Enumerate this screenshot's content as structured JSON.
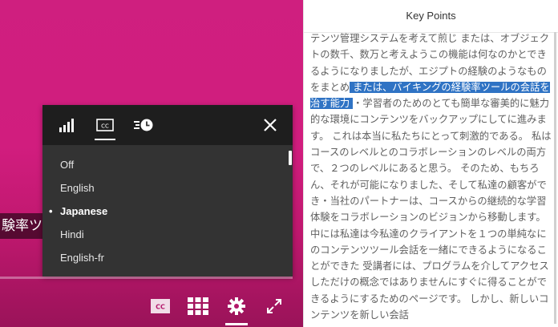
{
  "video": {
    "caption_fragment": "験率ツ",
    "background_color": "#cf1f7f"
  },
  "caption_menu": {
    "tabs": [
      {
        "icon": "signal-bars-icon"
      },
      {
        "icon": "closed-captions-icon",
        "active": true
      },
      {
        "icon": "playback-speed-icon"
      }
    ],
    "close_icon": "close-icon",
    "options": [
      "Off",
      "English",
      "Japanese",
      "Hindi",
      "English-fr"
    ],
    "selected": "Japanese",
    "bullet": "•"
  },
  "controls": {
    "buttons": [
      {
        "icon": "closed-captions-icon",
        "label": "CC"
      },
      {
        "icon": "grid-icon"
      },
      {
        "icon": "settings-gear-icon"
      },
      {
        "icon": "fullscreen-icon"
      }
    ]
  },
  "key_points": {
    "title": "Key Points",
    "text_before": "テンツ管理システムを考えて煎じ または、オブジェクトの数千、数万と考えようこの機能は何なのかとできるようになりましたが、エジプトの経験のようなものをまとめ",
    "text_highlight": " または、バイキングの経験率ツールの会話を治す能力 ",
    "text_after": "・学習者のためのとても簡単な審美的に魅力的な環境にコンテンツをバックアップにしてに進みます。 これは本当に私たちにとって刺激的である。 私はコースのレベルとのコラボレーションのレベルの両方で、２つのレベルにあると思う。 そのため、もちろん、それが可能になりました、そして私達の顧客ができ・当社のパートナーは、コースからの継続的な学習体験をコラボレーションのビジョンから移動します。 中には私達は今私達のクライアントを１つの単純なにのコンテンツツール会話を一緒にできるようになることができた 受講者には、プログラムを介してアクセスしただけの概念ではありませんにすぐに得ることができるようにするためのページです。 しかし、新しいコンテンツを新しい会話",
    "highlight_color": "#2f73c4"
  }
}
